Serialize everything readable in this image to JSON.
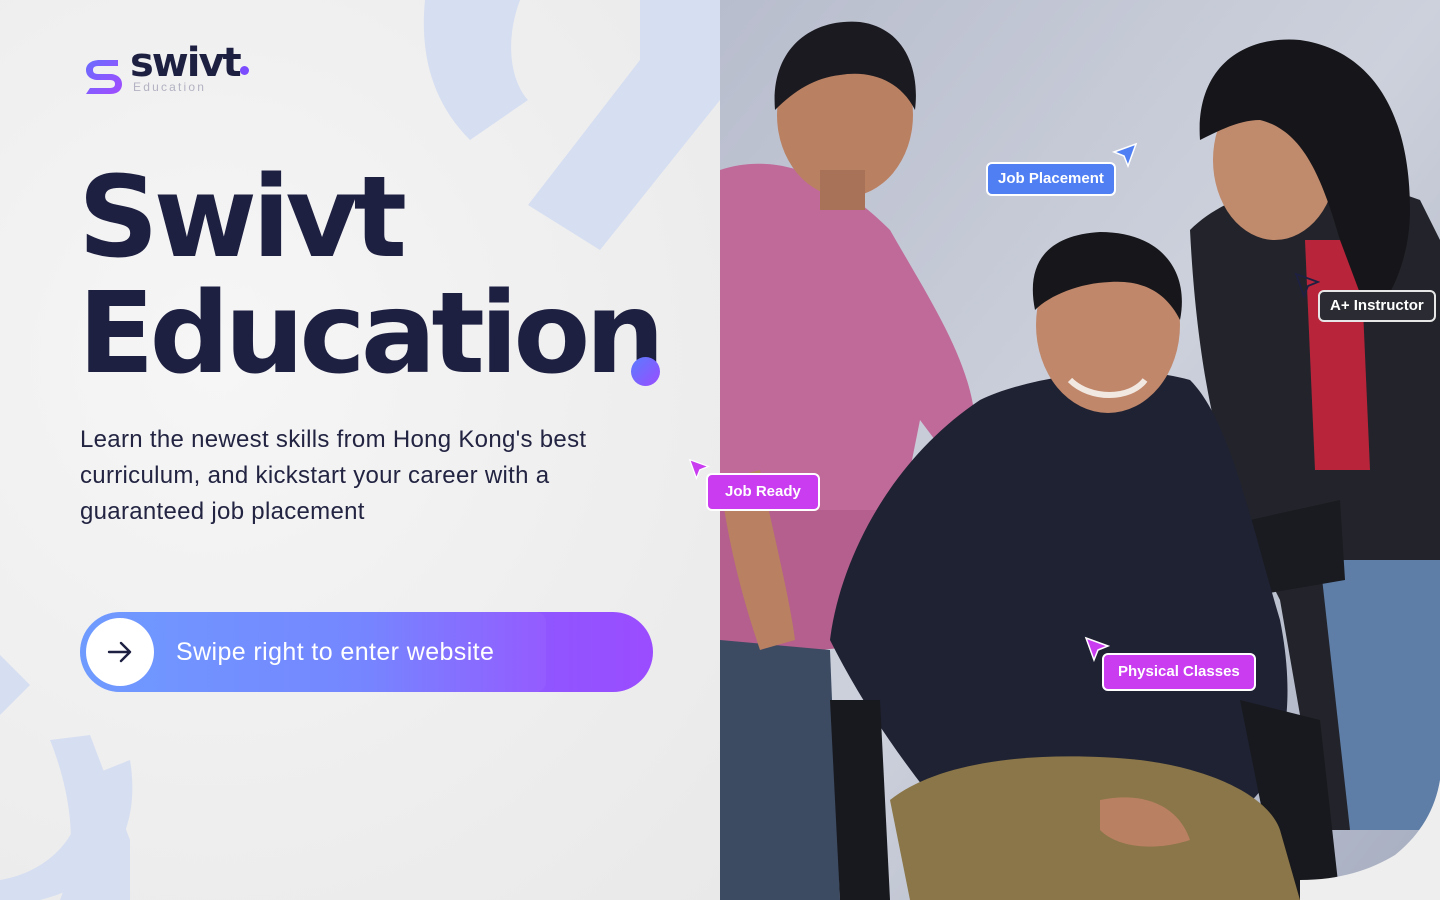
{
  "brand": {
    "name": "swivt",
    "tagline": "Education"
  },
  "hero": {
    "title_line1": "Swivt",
    "title_line2": "Education",
    "subtitle": "Learn the newest skills from Hong Kong's best curriculum, and kickstart your career with a guaranteed job placement"
  },
  "cta": {
    "label": "Swipe right to enter website",
    "icon": "arrow-right-icon"
  },
  "tags": {
    "job_placement": "Job Placement",
    "instructor": "A+ Instructor",
    "job_ready": "Job Ready",
    "physical_classes": "Physical Classes"
  },
  "colors": {
    "ink": "#1e2042",
    "accent_blue": "#5b8dff",
    "accent_purple": "#9b4cff",
    "tag_blue": "#4f7ff3",
    "tag_pink": "#c93cf0",
    "tag_dark": "#2b2c33"
  }
}
